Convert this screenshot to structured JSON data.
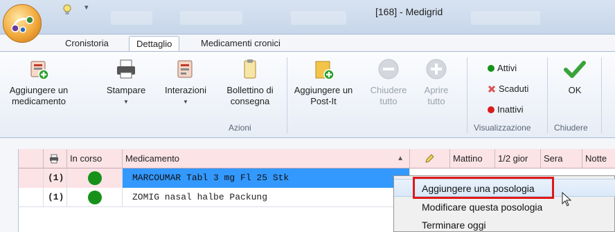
{
  "window": {
    "title": "[168] - Medigrid"
  },
  "tabs": [
    {
      "label": "Cronistoria"
    },
    {
      "label": "Dettaglio"
    },
    {
      "label": "Medicamenti cronici"
    }
  ],
  "ribbon": {
    "buttons": {
      "add_medicament": "Aggiungere un medicamento",
      "print": "Stampare",
      "interactions": "Interazioni",
      "delivery_note": "Bollettino di consegna",
      "add_postit": "Aggiungere un Post-It",
      "collapse_all": "Chiudere tutto",
      "expand_all": "Aprire tutto",
      "ok": "OK"
    },
    "groups": {
      "actions": "Azioni",
      "view": "Visualizzazione",
      "close": "Chiudere"
    },
    "view_items": {
      "active": "Attivi",
      "expired": "Scaduti",
      "inactive": "Inattivi"
    }
  },
  "grid": {
    "headers": {
      "in_progress": "In corso",
      "medicament": "Medicamento",
      "sort_marker": "▲",
      "morning": "Mattino",
      "half_day": "1/2 gior",
      "evening": "Sera",
      "night": "Notte"
    },
    "rows": [
      {
        "count": "(1)",
        "name": "MARCOUMAR Tabl 3 mg Fl 25 Stk"
      },
      {
        "count": "(1)",
        "name": "ZOMIG nasal halbe Packung"
      }
    ]
  },
  "context_menu": {
    "items": [
      {
        "label": "Aggiungere una posologia"
      },
      {
        "label": "Modificare questa posologia"
      },
      {
        "label": "Terminare oggi"
      }
    ]
  },
  "colors": {
    "status_active": "#17911a",
    "status_inactive": "#d81b1b",
    "row_selected": "#3399ff",
    "header_pink": "#fbe3e6",
    "highlight_red": "#e01818"
  }
}
